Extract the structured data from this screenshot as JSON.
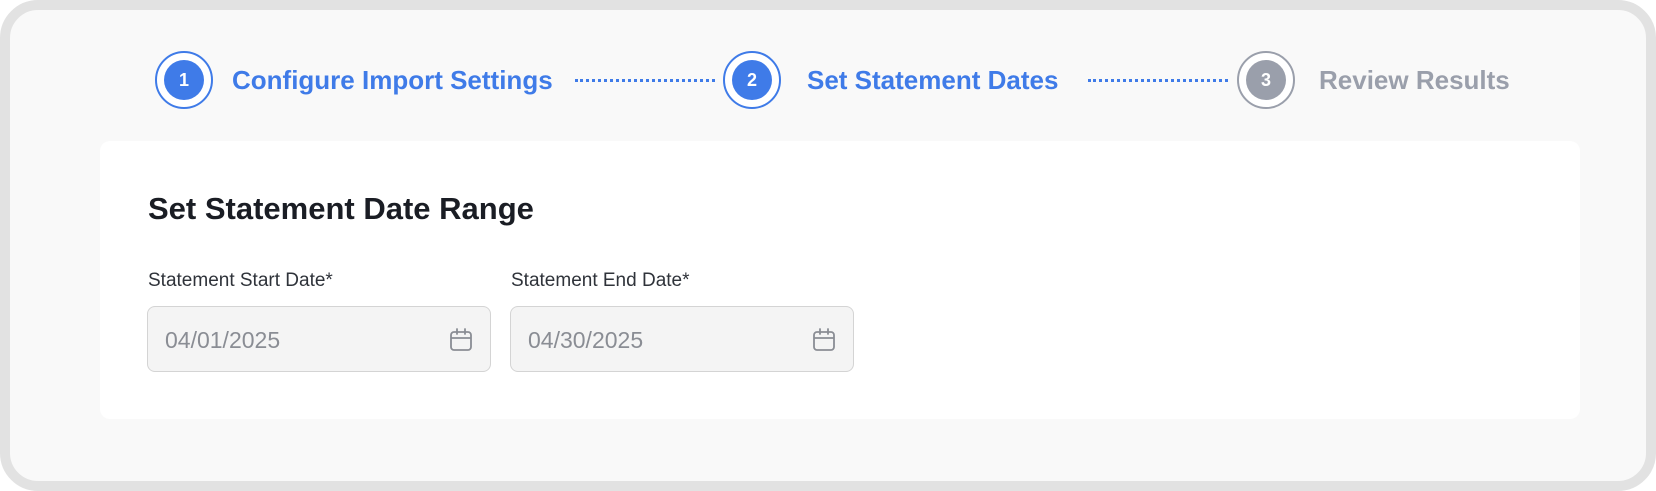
{
  "stepper": {
    "steps": [
      {
        "number": "1",
        "label": "Configure Import Settings",
        "state": "completed"
      },
      {
        "number": "2",
        "label": "Set Statement Dates",
        "state": "active"
      },
      {
        "number": "3",
        "label": "Review Results",
        "state": "inactive"
      }
    ]
  },
  "form": {
    "title": "Set Statement Date Range",
    "start_date": {
      "label": "Statement Start Date*",
      "value": "04/01/2025",
      "icon": "calendar-icon"
    },
    "end_date": {
      "label": "Statement End Date*",
      "value": "04/30/2025",
      "icon": "calendar-icon"
    }
  },
  "colors": {
    "accent": "#3f7be8",
    "inactive": "#9a9fab",
    "title": "#1a1d24"
  }
}
